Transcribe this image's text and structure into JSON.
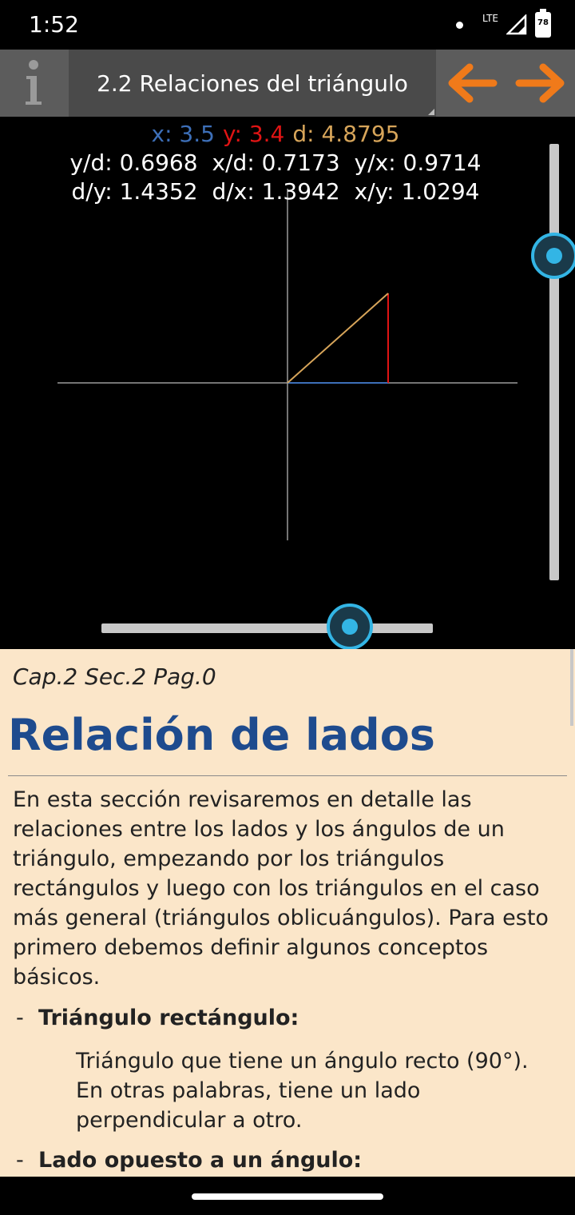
{
  "status_bar": {
    "time": "1:52",
    "network": "LTE",
    "battery": "78"
  },
  "toolbar": {
    "title": "2.2 Relaciones del triángulo"
  },
  "readout": {
    "x": "x: 3.5",
    "y": "y: 3.4",
    "d": "d: 4.8795",
    "ratios_row1": [
      "y/d: 0.6968",
      "x/d: 0.7173",
      "y/x: 0.9714"
    ],
    "ratios_row2": [
      "d/y: 1.4352",
      "d/x: 1.3942",
      "x/y: 1.0294"
    ]
  },
  "colors": {
    "x_side": "#3d6fb8",
    "y_side": "#e01414",
    "d_side": "#d7a55a",
    "slider": "#33b5e5",
    "heading": "#1e4b8e"
  },
  "content": {
    "chapter": "Cap.2 Sec.2 Pag.0",
    "heading": "Relación de lados",
    "paragraph": "En esta sección revisaremos en detalle las relaciones entre los lados y los ángulos de un triángulo, empezando por los triángulos rectángulos y luego con los triángulos en el caso más general (triángulos oblicuángulos). Para esto primero debemos definir algunos conceptos básicos.",
    "items": [
      {
        "dash": "-",
        "term": "Triángulo rectángulo:",
        "definition": "Triángulo que tiene un ángulo recto (90°). En otras palabras, tiene un lado perpendicular a otro."
      },
      {
        "dash": "-",
        "term": "Lado opuesto a un ángulo:"
      }
    ]
  }
}
